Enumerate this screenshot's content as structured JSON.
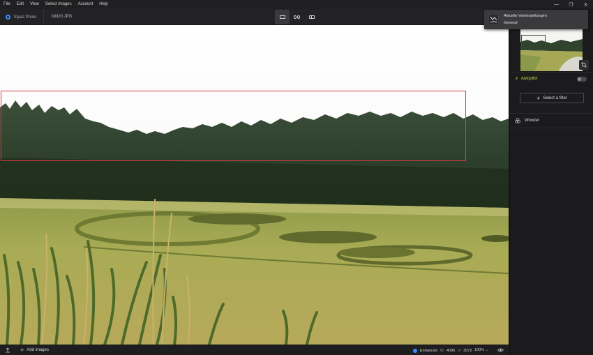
{
  "menu": [
    "File",
    "Edit",
    "View",
    "Select images",
    "Account",
    "Help"
  ],
  "window_controls": {
    "minimize": "—",
    "restore": "❐",
    "close": "✕"
  },
  "toolbar": {
    "brand": "Topaz Photo",
    "filename": "bild20.JPG",
    "view_modes": [
      "single-view-icon",
      "side-by-side-icon",
      "split-view-icon"
    ],
    "active_view": "single-view-icon"
  },
  "bottom_bar": {
    "add_images": "Add images",
    "status": "Enhanced",
    "width_label": "W",
    "width": "4096",
    "height_label": "H",
    "height": "3072",
    "zoom": "100%"
  },
  "panel": {
    "autopilot_label": "Autopilot",
    "autopilot_enabled": false,
    "select_filter": "Select a filter",
    "filter_name": "Wonder"
  },
  "notification": {
    "title": "Aktuelle Voreinstellungen",
    "subtitle": "General"
  },
  "colors": {
    "accent_blue": "#3b8cff",
    "autopilot_green": "#b8e63a",
    "roi_red": "#e03a3a"
  }
}
